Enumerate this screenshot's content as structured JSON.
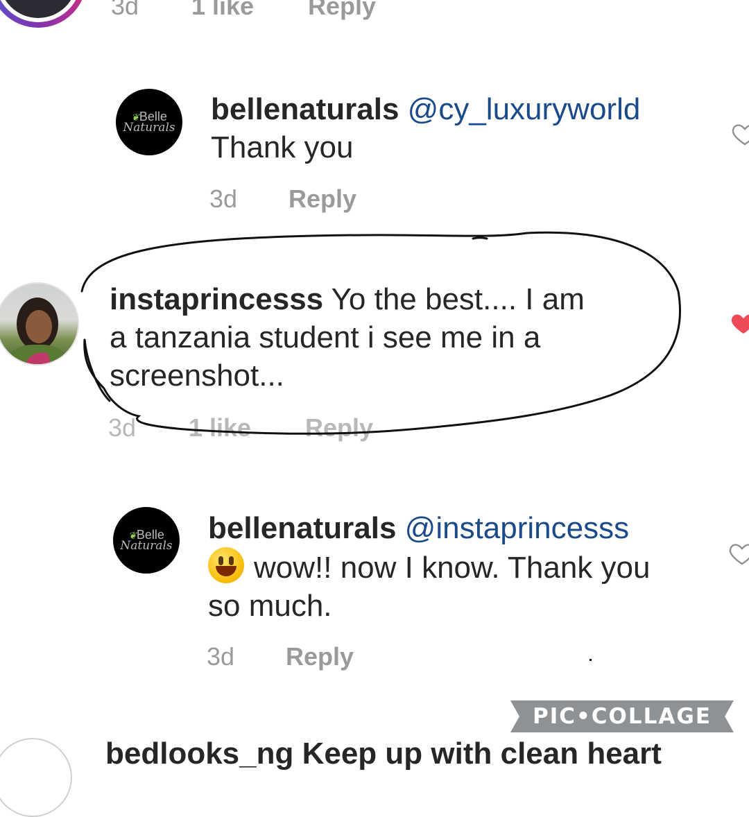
{
  "top_row": {
    "time": "3d",
    "likes": "1 like",
    "reply": "Reply"
  },
  "comments": [
    {
      "username": "bellenaturals",
      "mention": "@cy_luxuryworld",
      "text": "Thank you",
      "time": "3d",
      "reply": "Reply",
      "liked": false
    },
    {
      "username": "instaprincesss",
      "text_line1": "Yo the best.... I am",
      "text_line2": "a tanzania student i see me in a",
      "text_line3": "screenshot...",
      "time": "3d",
      "likes": "1 like",
      "reply": "Reply",
      "liked": true
    },
    {
      "username": "bellenaturals",
      "mention": "@instaprincesss",
      "text_line1": "wow!! now I know. Thank you",
      "text_line2": "so much.",
      "time": "3d",
      "reply": "Reply",
      "liked": false
    }
  ],
  "logo": {
    "brand": "Belle",
    "sub": "Naturals"
  },
  "bottom_partial": "bedlooks_ng Keep up with clean heart",
  "watermark": "PIC•COLLAGE",
  "colors": {
    "mention": "#1b4a8a",
    "heart_liked": "#ed4956",
    "meta": "#9a9a9a"
  }
}
